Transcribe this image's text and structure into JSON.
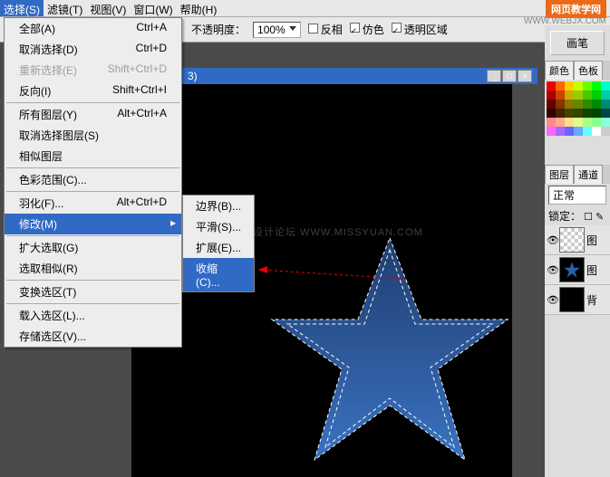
{
  "menubar": {
    "items": [
      "选择(S)",
      "滤镜(T)",
      "视图(V)",
      "窗口(W)",
      "帮助(H)"
    ]
  },
  "toolbar": {
    "opacity_label": "不透明度：",
    "opacity_value": "100%",
    "invert": "反相",
    "dither": "仿色",
    "transparent": "透明区域"
  },
  "brand": {
    "title": "网页教学网",
    "url": "WWW.WEBJX.COM"
  },
  "dropdown": {
    "items": [
      {
        "label": "全部(A)",
        "shortcut": "Ctrl+A"
      },
      {
        "label": "取消选择(D)",
        "shortcut": "Ctrl+D"
      },
      {
        "label": "重新选择(E)",
        "shortcut": "Shift+Ctrl+D",
        "disabled": true
      },
      {
        "label": "反向(I)",
        "shortcut": "Shift+Ctrl+I"
      },
      {
        "sep": true
      },
      {
        "label": "所有图层(Y)",
        "shortcut": "Alt+Ctrl+A"
      },
      {
        "label": "取消选择图层(S)"
      },
      {
        "label": "相似图层"
      },
      {
        "sep": true
      },
      {
        "label": "色彩范围(C)..."
      },
      {
        "sep": true
      },
      {
        "label": "羽化(F)...",
        "shortcut": "Alt+Ctrl+D"
      },
      {
        "label": "修改(M)",
        "hl": true,
        "sub": true
      },
      {
        "sep": true
      },
      {
        "label": "扩大选取(G)"
      },
      {
        "label": "选取相似(R)"
      },
      {
        "sep": true
      },
      {
        "label": "变换选区(T)"
      },
      {
        "sep": true
      },
      {
        "label": "载入选区(L)..."
      },
      {
        "label": "存储选区(V)..."
      }
    ]
  },
  "submenu": {
    "items": [
      "边界(B)...",
      "平滑(S)...",
      "扩展(E)...",
      "收缩(C)..."
    ]
  },
  "doc": {
    "title": "3)",
    "min": "_",
    "max": "□",
    "close": "×"
  },
  "watermark": "思缘设计论坛  WWW.MISSYUAN.COM",
  "right": {
    "brush_btn": "画笔",
    "color_tab": "颜色",
    "swatch_tab": "色板",
    "layers_tab": "图层",
    "channels_tab": "通道",
    "blend_mode": "正常",
    "lock_label": "锁定：",
    "layer1": "图",
    "layer2": "图",
    "layer3": "背"
  },
  "swatch_colors": [
    "#e00",
    "#f60",
    "#fc0",
    "#cf0",
    "#6f0",
    "#0f0",
    "#0fc",
    "#a00",
    "#c40",
    "#ca0",
    "#9c0",
    "#4c0",
    "#0c0",
    "#0ca",
    "#600",
    "#830",
    "#870",
    "#680",
    "#380",
    "#080",
    "#087",
    "#300",
    "#420",
    "#440",
    "#340",
    "#140",
    "#040",
    "#044",
    "#f88",
    "#fa8",
    "#fd8",
    "#df8",
    "#af8",
    "#8f8",
    "#8fd",
    "#f6f",
    "#a6f",
    "#66f",
    "#6af",
    "#6ff",
    "#fff",
    "#ccc"
  ]
}
